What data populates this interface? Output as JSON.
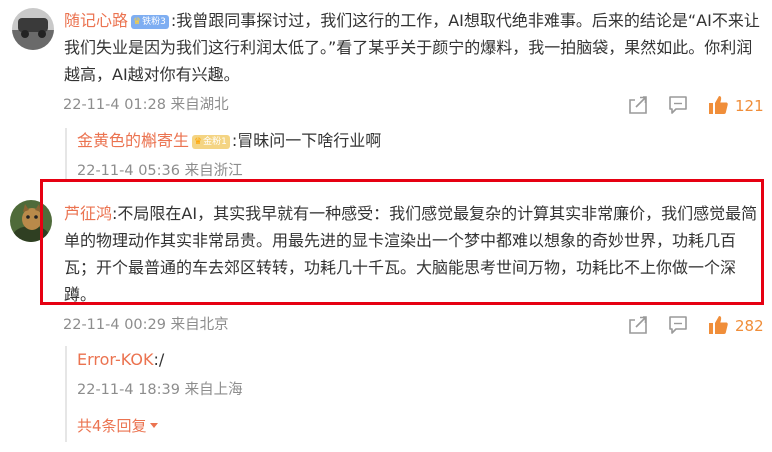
{
  "comments": [
    {
      "user": "随记心路",
      "badge": "铁粉3",
      "text": ":我曾跟同事探讨过，我们这行的工作，AI想取代绝非难事。后来的结论是“AI不来让我们失业是因为我们这行利润太低了。”看了某乎关于颜宁的爆料，我一拍脑袋，果然如此。你利润越高，AI越对你有兴趣。",
      "meta": "22-11-4 01:28 来自湖北",
      "likes": "121",
      "replies": [
        {
          "user": "金黄色的槲寄生",
          "badge": "金粉1",
          "text": ":冒昧问一下啥行业啊",
          "meta": "22-11-4 05:36 来自浙江"
        }
      ]
    },
    {
      "user": "芦征鸿",
      "text": ":不局限在AI，其实我早就有一种感受：我们感觉最复杂的计算其实非常廉价，我们感觉最简单的物理动作其实非常昂贵。用最先进的显卡渲染出一个梦中都难以想象的奇妙世界，功耗几百瓦；开个最普通的车去郊区转转，功耗几十千瓦。大脑能思考世间万物，功耗比不上你做一个深蹲。",
      "meta": "22-11-4 00:29 来自北京",
      "likes": "282",
      "replies": [
        {
          "user": "Error-KOK",
          "text": ":/",
          "meta": "22-11-4 18:39 来自上海"
        }
      ],
      "more_replies": "共4条回复"
    }
  ],
  "icons": {
    "share": "share-icon",
    "comment": "comment-icon",
    "like": "thumbs-up-icon",
    "expand": "chevron-down-icon"
  },
  "colors": {
    "username": "#eb7350",
    "like": "#f08e3a",
    "highlight_border": "#e60012",
    "meta": "#8d8d8d"
  }
}
